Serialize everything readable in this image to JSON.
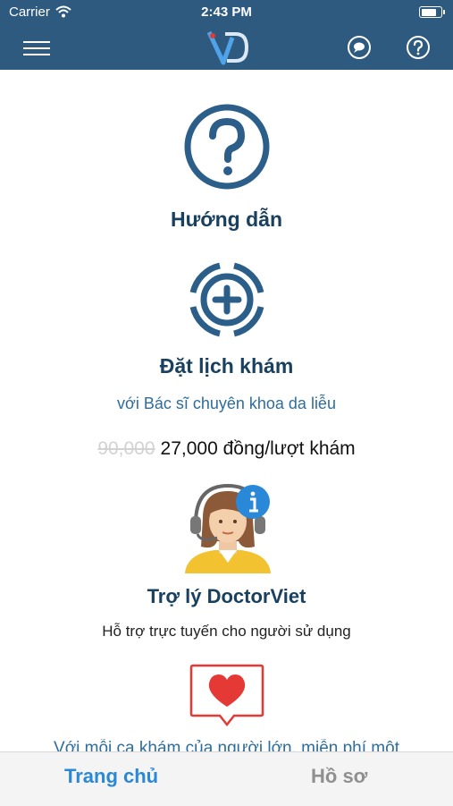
{
  "status_bar": {
    "carrier": "Carrier",
    "time": "2:43 PM",
    "battery_level": 0.9
  },
  "nav": {
    "logo_icon": "doctorviet-logo",
    "menu_icon": "hamburger-menu-icon",
    "chat_icon": "chat-bubble-icon",
    "help_icon": "help-circle-icon"
  },
  "sections": {
    "guide": {
      "title": "Hướng dẫn",
      "icon": "question-circle-icon"
    },
    "booking": {
      "title": "Đặt lịch khám",
      "subtitle": "với Bác sĩ chuyên khoa da liễu",
      "old_price": "90,000",
      "price": "27,000 đồng/lượt khám",
      "icon": "plus-circle-icon"
    },
    "assistant": {
      "title": "Trợ lý DoctorViet",
      "description": "Hỗ trợ trực tuyến cho người sử dụng",
      "icon": "support-agent-icon"
    },
    "promo": {
      "teaser": "Với mỗi ca khám của người lớn, miễn phí một",
      "icon": "heart-message-icon"
    }
  },
  "tabs": [
    {
      "label": "Trang chủ",
      "active": true
    },
    {
      "label": "Hồ sơ",
      "active": false
    }
  ],
  "colors": {
    "nav_bg": "#2f5a80",
    "title": "#19405f",
    "accent_blue": "#2e6d9e",
    "tab_active": "#2a88d8",
    "tab_inactive": "#8f8f8f",
    "heart_red": "#e53935"
  }
}
